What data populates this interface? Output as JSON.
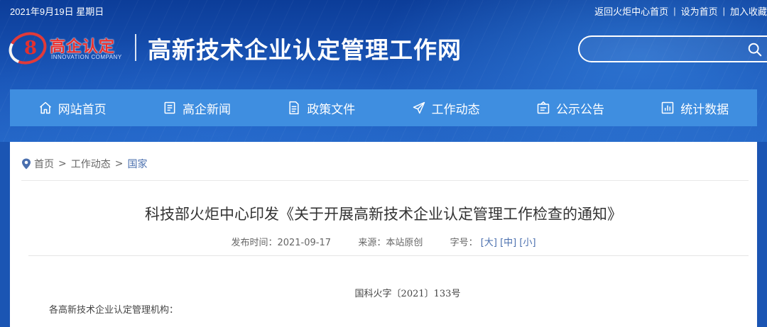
{
  "topbar": {
    "date": "2021年9月19日 星期日",
    "links": [
      "返回火炬中心首页",
      "设为首页",
      "加入收藏"
    ],
    "separator": "|"
  },
  "logo": {
    "cn": "高企认定",
    "en": "INNOVATION COMPANY",
    "emblem_char": "8"
  },
  "site_title": "高新技术企业认定管理工作网",
  "search": {
    "placeholder": "",
    "icon": "search-icon"
  },
  "nav": {
    "items": [
      {
        "label": "网站首页",
        "icon": "home-icon"
      },
      {
        "label": "高企新闻",
        "icon": "news-icon"
      },
      {
        "label": "政策文件",
        "icon": "document-icon"
      },
      {
        "label": "工作动态",
        "icon": "send-icon"
      },
      {
        "label": "公示公告",
        "icon": "notice-icon"
      },
      {
        "label": "统计数据",
        "icon": "chart-icon"
      }
    ]
  },
  "breadcrumb": {
    "items": [
      "首页",
      "工作动态",
      "国家"
    ],
    "separator": ">"
  },
  "article": {
    "title": "科技部火炬中心印发《关于开展高新技术企业认定管理工作检查的通知》",
    "published_label": "发布时间：",
    "published_date": "2021-09-17",
    "source_label": "来源：",
    "source": "本站原创",
    "font_size_label": "字号：",
    "font_sizes": [
      "[大]",
      "[中]",
      "[小]"
    ],
    "doc_number": "国科火字〔2021〕133号",
    "salutation": "各高新技术企业认定管理机构："
  },
  "colors": {
    "header_blue": "#1a56b8",
    "nav_blue": "#3f8ee0",
    "logo_red": "#e8312f",
    "link_blue": "#4a6fae"
  }
}
